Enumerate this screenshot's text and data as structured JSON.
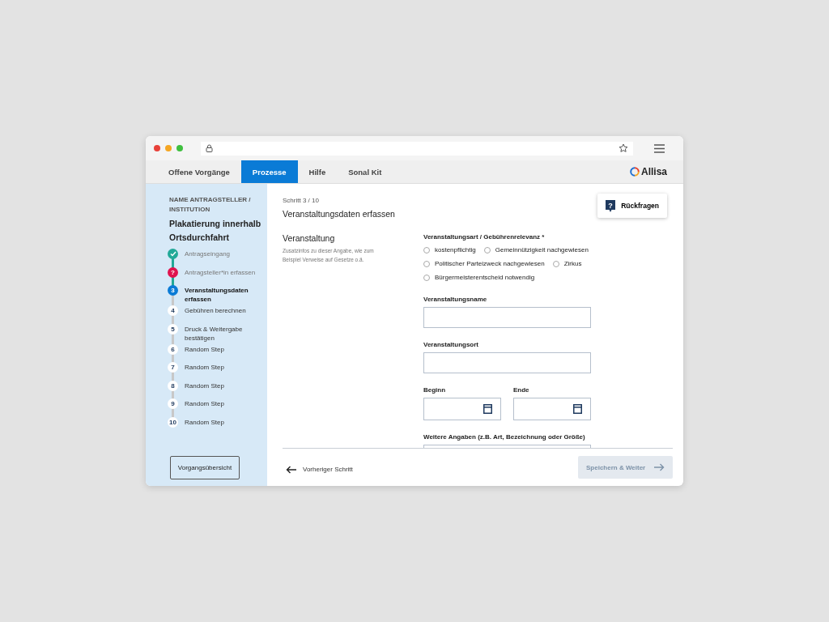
{
  "nav": {
    "tabs": [
      {
        "label": "Offene Vorgänge",
        "selected": false
      },
      {
        "label": "Prozesse",
        "selected": true
      },
      {
        "label": "Hilfe",
        "selected": false
      },
      {
        "label": "Sonal Kit",
        "selected": false
      }
    ],
    "logo": "Allisa"
  },
  "sidebar": {
    "applicant": "NAME ANTRAGSTELLER / INSTITUTION",
    "title": "Plakatierung innerhalb Ortsdurchfahrt",
    "steps": [
      {
        "kind": "done",
        "label": "Antragseingang"
      },
      {
        "kind": "question",
        "marker": "?",
        "label": "Antragsteller*in erfassen"
      },
      {
        "kind": "current",
        "marker": "3",
        "label": "Veranstaltungsdaten erfassen"
      },
      {
        "kind": "todo",
        "marker": "4",
        "label": "Gebühren berechnen"
      },
      {
        "kind": "todo",
        "marker": "5",
        "label": "Druck & Weitergabe bestätigen"
      },
      {
        "kind": "todo",
        "marker": "6",
        "label": "Random Step"
      },
      {
        "kind": "todo",
        "marker": "7",
        "label": "Random Step"
      },
      {
        "kind": "todo",
        "marker": "8",
        "label": "Random Step"
      },
      {
        "kind": "todo",
        "marker": "9",
        "label": "Random Step"
      },
      {
        "kind": "todo",
        "marker": "10",
        "label": "Random Step"
      }
    ],
    "overview_button": "Vorgangsübersicht"
  },
  "header": {
    "step": "Schritt 3 / 10",
    "title": "Veranstaltungsdaten erfassen",
    "ask_button": "Rückfragen"
  },
  "section": {
    "title": "Veranstaltung",
    "hint": "Zusatzinfos zu dieser Angabe, wie zum Beispiel Verweise auf Gesetze o.ä."
  },
  "radio_group": {
    "label": "Veranstaltungsart / Gebührenrelevanz *",
    "options": [
      {
        "label": "kostenpflichtig",
        "selected": false
      },
      {
        "label": "Gemeinnützigkeit nachgewiesen",
        "selected": false
      },
      {
        "label": "Politischer Parteizweck nachgewiesen",
        "selected": false
      },
      {
        "label": "Zirkus",
        "selected": false
      },
      {
        "label": "Bürgermeisterentscheid notwendig",
        "selected": false
      }
    ]
  },
  "fields": [
    {
      "kind": "text",
      "label": "Veranstaltungsname"
    },
    {
      "kind": "text",
      "label": "Veranstaltungsort"
    },
    {
      "kind": "dates",
      "label": "Beginn",
      "label2": "Ende"
    },
    {
      "kind": "text",
      "label": "Weitere Angaben (z.B. Art, Bezeichnung oder Größe)"
    }
  ],
  "footer": {
    "back": "Vorheriger Schritt",
    "save": "Speichern & Weiter",
    "save_disabled": true
  }
}
